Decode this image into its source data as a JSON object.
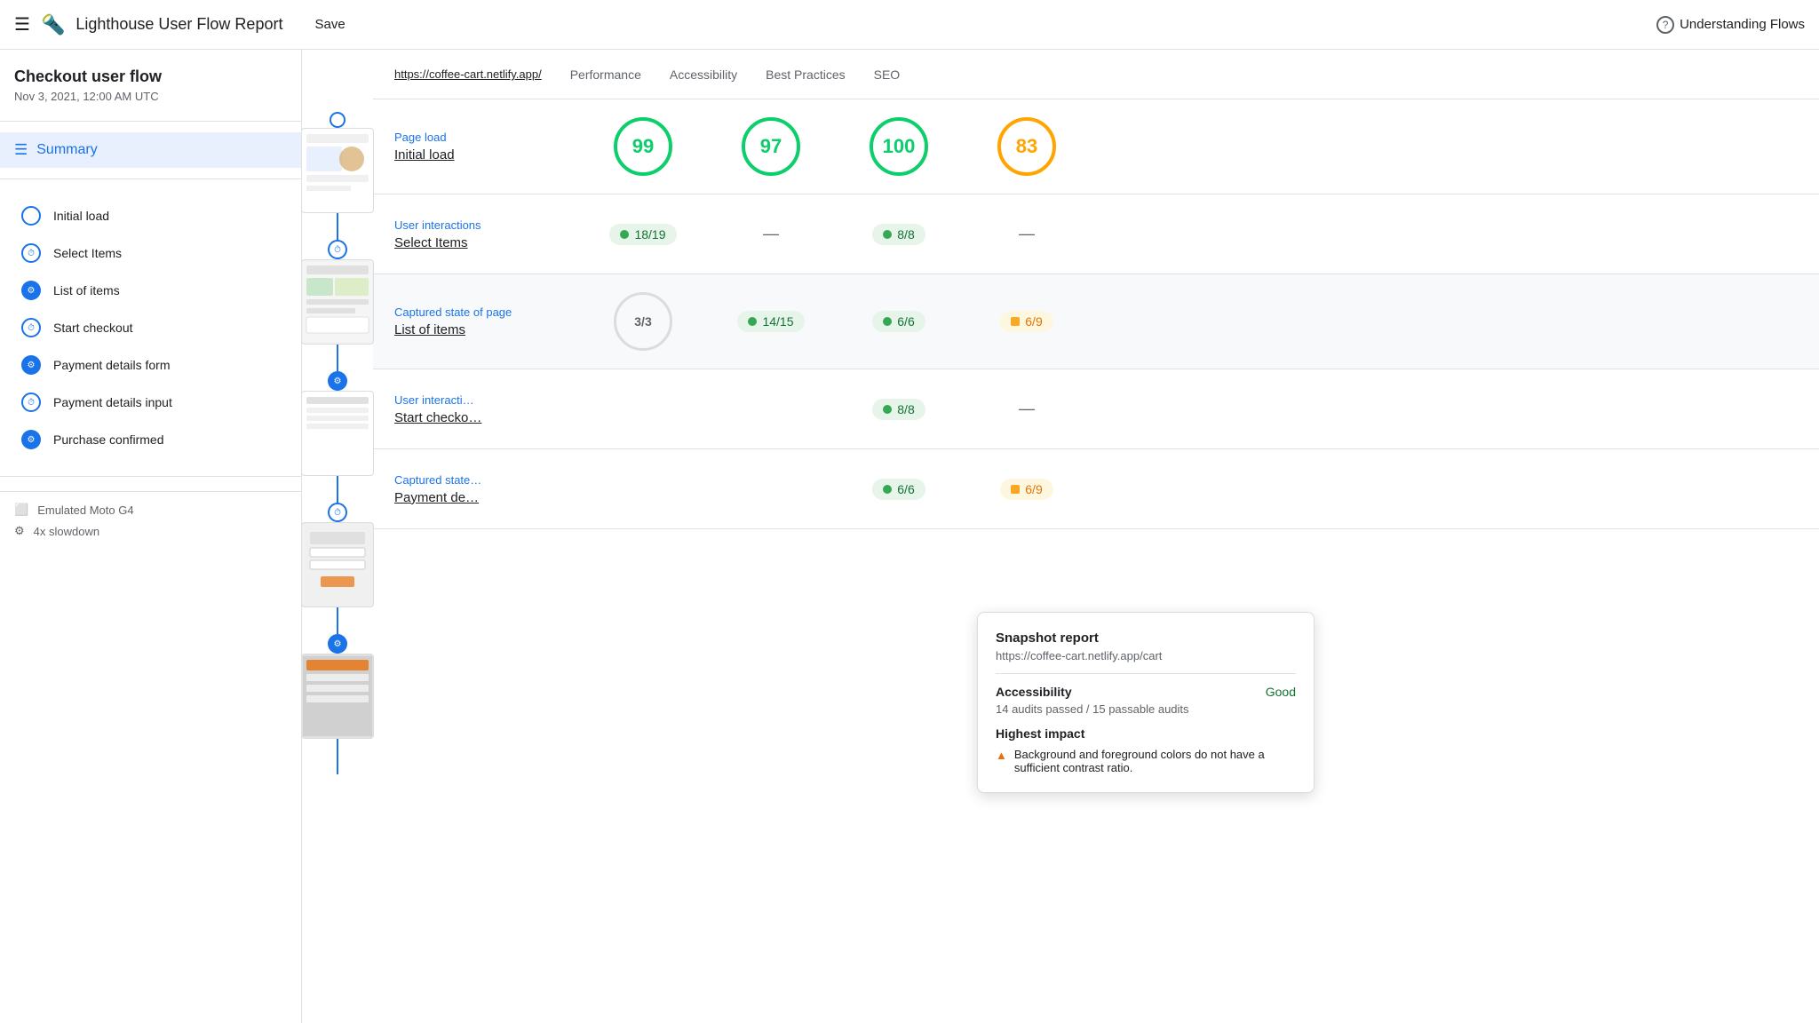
{
  "app": {
    "title": "Lighthouse User Flow Report",
    "save_label": "Save",
    "help_label": "Understanding Flows"
  },
  "sidebar": {
    "flow_title": "Checkout user flow",
    "flow_date": "Nov 3, 2021, 12:00 AM UTC",
    "summary_label": "Summary",
    "nav_items": [
      {
        "id": "initial-load",
        "label": "Initial load",
        "type": "circle"
      },
      {
        "id": "select-items",
        "label": "Select Items",
        "type": "clock"
      },
      {
        "id": "list-of-items",
        "label": "List of items",
        "type": "camera"
      },
      {
        "id": "start-checkout",
        "label": "Start checkout",
        "type": "clock"
      },
      {
        "id": "payment-details-form",
        "label": "Payment details form",
        "type": "camera"
      },
      {
        "id": "payment-details-input",
        "label": "Payment details input",
        "type": "clock"
      },
      {
        "id": "purchase-confirmed",
        "label": "Purchase confirmed",
        "type": "camera"
      }
    ],
    "device_label": "Emulated Moto G4",
    "slowdown_label": "4x slowdown"
  },
  "url_bar": {
    "url": "https://coffee-cart.netlify.app/",
    "col_performance": "Performance",
    "col_accessibility": "Accessibility",
    "col_best_practices": "Best Practices",
    "col_seo": "SEO"
  },
  "sections": [
    {
      "id": "initial-load",
      "type": "Page load",
      "name": "Initial load",
      "perf_score": "99",
      "perf_type": "circle",
      "perf_color": "green",
      "access_score": "97",
      "access_type": "circle",
      "access_color": "green",
      "bp_score": "100",
      "bp_type": "circle",
      "bp_color": "green",
      "seo_score": "83",
      "seo_type": "circle",
      "seo_color": "orange"
    },
    {
      "id": "select-items",
      "type": "User interactions",
      "name": "Select Items",
      "perf_score": "18/19",
      "perf_type": "pill",
      "perf_color": "green",
      "access_score": "—",
      "access_type": "dash",
      "bp_score": "8/8",
      "bp_type": "pill",
      "bp_color": "green",
      "seo_score": "—",
      "seo_type": "dash"
    },
    {
      "id": "list-of-items",
      "type": "Captured state of page",
      "name": "List of items",
      "perf_score": "3/3",
      "perf_type": "pill-outline",
      "access_score": "14/15",
      "access_type": "pill",
      "access_color": "green",
      "bp_score": "6/6",
      "bp_type": "pill",
      "bp_color": "green",
      "seo_score": "6/9",
      "seo_type": "pill",
      "seo_color": "orange",
      "highlighted": true
    },
    {
      "id": "start-checkout",
      "type": "User interactions",
      "name": "Start checkout",
      "perf_score": "",
      "perf_type": "empty",
      "access_score": "",
      "access_type": "empty",
      "bp_score": "8/8",
      "bp_type": "pill",
      "bp_color": "green",
      "seo_score": "—",
      "seo_type": "dash"
    },
    {
      "id": "payment-details-form",
      "type": "Captured state",
      "name": "Payment de…",
      "perf_score": "",
      "perf_type": "empty",
      "access_score": "",
      "access_type": "empty",
      "bp_score": "6/6",
      "bp_type": "pill",
      "bp_color": "green",
      "seo_score": "6/9",
      "seo_type": "pill",
      "seo_color": "orange"
    }
  ],
  "tooltip": {
    "title": "Snapshot report",
    "url": "https://coffee-cart.netlify.app/cart",
    "accessibility_label": "Accessibility",
    "accessibility_value": "Good",
    "accessibility_sub": "14 audits passed / 15 passable audits",
    "highest_impact_label": "Highest impact",
    "impact_text": "Background and foreground colors do not have a sufficient contrast ratio."
  },
  "icons": {
    "hamburger": "☰",
    "logo": "🔦",
    "help_circle": "?",
    "clock": "🕐",
    "camera": "📷",
    "device": "⬜",
    "slowdown": "⚙"
  }
}
